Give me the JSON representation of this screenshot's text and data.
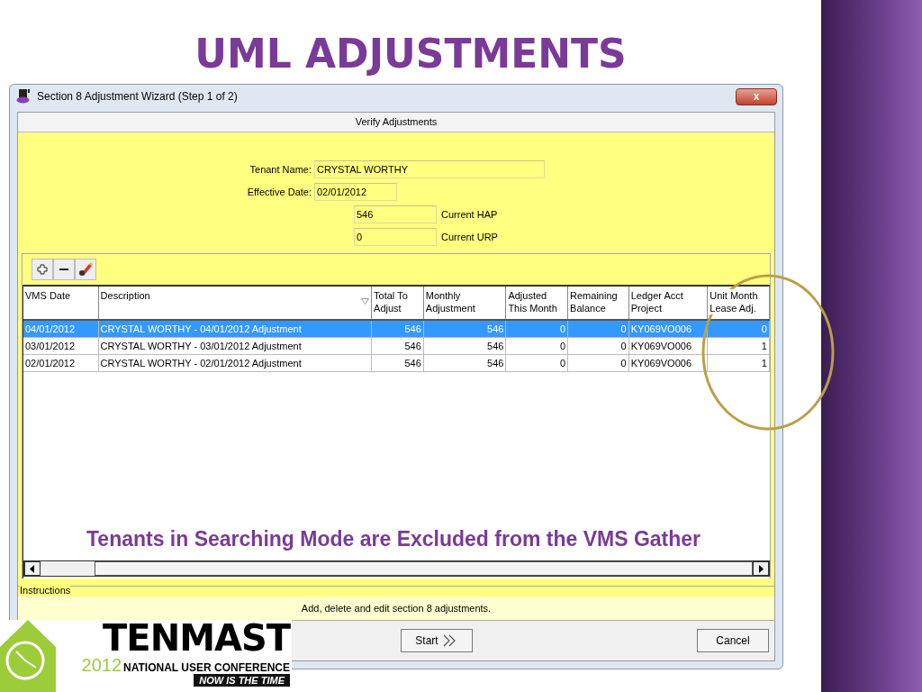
{
  "slide": {
    "title": "UML ADJUSTMENTS",
    "note": "Tenants in Searching Mode are Excluded from the VMS Gather"
  },
  "window": {
    "title": "Section 8 Adjustment Wizard (Step 1 of 2)",
    "close": "x"
  },
  "header": "Verify Adjustments",
  "form": {
    "tenant_name": {
      "label": "Tenant Name:",
      "value": "CRYSTAL WORTHY"
    },
    "effective_date": {
      "label": "Effective Date:",
      "value": "02/01/2012"
    },
    "current_hap": {
      "label": "Current HAP",
      "value": "546"
    },
    "current_urp": {
      "label": "Current URP",
      "value": "0"
    }
  },
  "toolbar": [
    {
      "kind": "add"
    },
    {
      "kind": "remove"
    },
    {
      "kind": "edit"
    }
  ],
  "table": {
    "columns": [
      {
        "label": "VMS Date",
        "kind": "text",
        "sortable": false
      },
      {
        "label": "Description",
        "kind": "text",
        "sortable": true
      },
      {
        "label": "Total To Adjust",
        "kind": "number",
        "sortable": false
      },
      {
        "label": "Monthly Adjustment",
        "kind": "number",
        "sortable": false
      },
      {
        "label": "Adjusted This Month",
        "kind": "number",
        "sortable": false
      },
      {
        "label": "Remaining Balance",
        "kind": "number",
        "sortable": false
      },
      {
        "label": "Ledger Acct Project",
        "kind": "text",
        "sortable": false
      },
      {
        "label": "Unit Month Lease Adj.",
        "kind": "number",
        "sortable": false
      }
    ],
    "rows": [
      {
        "selected": true,
        "cells": [
          "04/01/2012",
          "CRYSTAL WORTHY - 04/01/2012 Adjustment",
          "546",
          "546",
          "0",
          "0",
          "KY069VO006",
          "0"
        ]
      },
      {
        "selected": false,
        "cells": [
          "03/01/2012",
          "CRYSTAL WORTHY - 03/01/2012 Adjustment",
          "546",
          "546",
          "0",
          "0",
          "KY069VO006",
          "1"
        ]
      },
      {
        "selected": false,
        "cells": [
          "02/01/2012",
          "CRYSTAL WORTHY - 02/01/2012 Adjustment",
          "546",
          "546",
          "0",
          "0",
          "KY069VO006",
          "1"
        ]
      }
    ]
  },
  "instructions": {
    "label": "Instructions",
    "text": "Add, delete and edit section 8 adjustments."
  },
  "buttons": {
    "start": "Start",
    "cancel": "Cancel"
  },
  "logo": {
    "name": "TENMAST",
    "year": "2012",
    "subtitle": "NATIONAL USER CONFERENCE",
    "tagline": "NOW IS THE TIME"
  }
}
